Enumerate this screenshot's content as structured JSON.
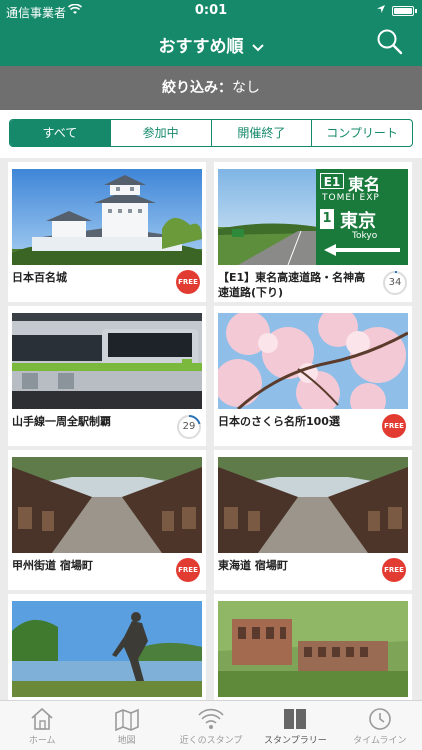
{
  "status_bar": {
    "carrier": "通信事業者",
    "time": "0:01"
  },
  "header": {
    "title": "おすすめ順",
    "chevron_icon": "chevron-down-icon",
    "search_icon": "search-icon",
    "bg": "#15896a"
  },
  "filter": {
    "label": "絞り込み：",
    "value": "なし"
  },
  "segments": [
    {
      "label": "すべて",
      "active": true
    },
    {
      "label": "参加中",
      "active": false
    },
    {
      "label": "開催終了",
      "active": false
    },
    {
      "label": "コンプリート",
      "active": false
    }
  ],
  "cards": [
    {
      "label": "日本百名城",
      "badge": "FREE"
    },
    {
      "label": "【E1】東名高速道路・名神高速道路(下り)",
      "badge_count": "34",
      "sign": {
        "route": "E1",
        "name": "東名",
        "roman": "TOMEI EXP",
        "exit_num": "1",
        "exit_name": "東京",
        "exit_roman": "Tokyo"
      }
    },
    {
      "label": "山手線一周全駅制覇",
      "badge_count": "29"
    },
    {
      "label": "日本のさくら名所100選",
      "badge": "FREE"
    },
    {
      "label": "甲州街道 宿場町",
      "badge": "FREE"
    },
    {
      "label": "東海道 宿場町",
      "badge": "FREE"
    },
    {
      "label": ""
    },
    {
      "label": ""
    }
  ],
  "tabbar": [
    {
      "label": "ホーム",
      "icon": "home-icon"
    },
    {
      "label": "地図",
      "icon": "map-icon"
    },
    {
      "label": "近くのスタンプ",
      "icon": "wifi-signal-icon"
    },
    {
      "label": "スタンプラリー",
      "icon": "book-icon",
      "active": true
    },
    {
      "label": "タイムライン",
      "icon": "clock-icon"
    }
  ]
}
